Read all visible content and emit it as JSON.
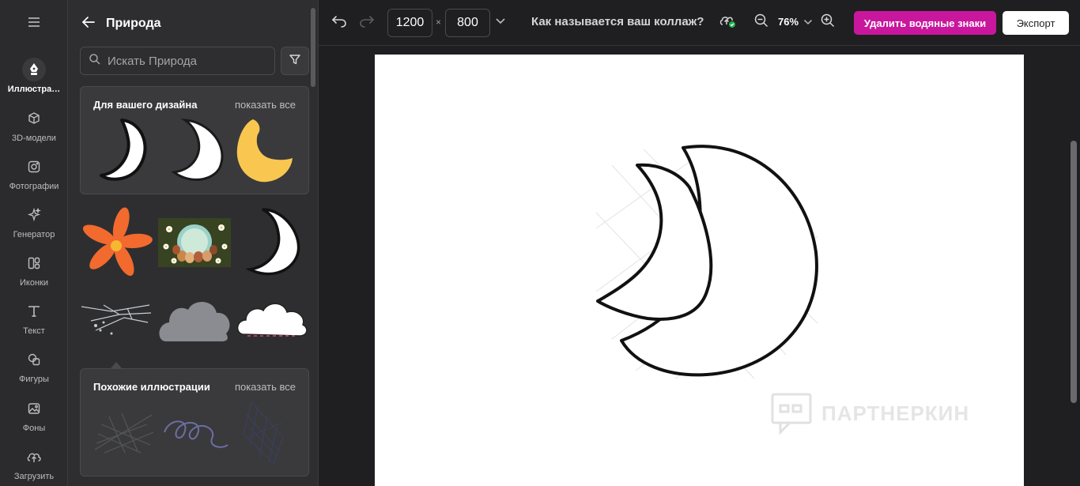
{
  "rail": {
    "items": [
      {
        "label": "Иллюстра…",
        "icon": "pen-nib-icon",
        "active": true
      },
      {
        "label": "3D-модели",
        "icon": "cube-icon"
      },
      {
        "label": "Фотографии",
        "icon": "camera-icon"
      },
      {
        "label": "Генератор",
        "icon": "sparkles-icon"
      },
      {
        "label": "Иконки",
        "icon": "grid-icon"
      },
      {
        "label": "Текст",
        "icon": "text-icon"
      },
      {
        "label": "Фигуры",
        "icon": "shapes-icon"
      },
      {
        "label": "Фоны",
        "icon": "image-icon"
      },
      {
        "label": "Загрузить",
        "icon": "cloud-upload-icon"
      }
    ]
  },
  "panel": {
    "title": "Природа",
    "search_placeholder": "Искать Природа",
    "card_design": {
      "title": "Для вашего дизайна",
      "link": "показать все"
    },
    "card_similar": {
      "title": "Похожие иллюстрации",
      "link": "показать все"
    }
  },
  "topbar": {
    "width_value": "1200",
    "height_value": "800",
    "times": "×",
    "collage_name": "Как называется ваш коллаж?",
    "zoom": "76%",
    "watermark_button": "Удалить водяные знаки",
    "export_button": "Экспорт"
  },
  "canvas": {
    "watermark": "ПАРТНЕРКИН"
  },
  "colors": {
    "accent": "#c8179d",
    "moon_yellow": "#f9c74f",
    "flower_orange": "#f26a2e",
    "cloud_gray": "#8a8c91"
  }
}
